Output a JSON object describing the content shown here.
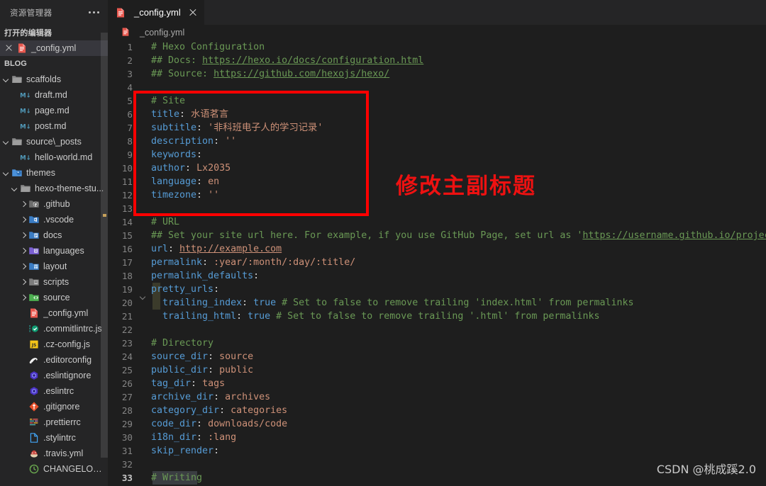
{
  "sidebar": {
    "title": "资源管理器",
    "more_icon": "ellipsis-icon",
    "open_editors_header": "打开的编辑器",
    "open_editor": {
      "name": "_config.yml",
      "icon": "yaml-file-icon",
      "close_icon": "close-icon"
    },
    "blog_header": "BLOG",
    "tree": [
      {
        "label": "scaffolds",
        "indent": 0,
        "twisty": "down",
        "icon": "folder-open-icon"
      },
      {
        "label": "draft.md",
        "indent": 1,
        "twisty": "none",
        "icon": "markdown-icon"
      },
      {
        "label": "page.md",
        "indent": 1,
        "twisty": "none",
        "icon": "markdown-icon"
      },
      {
        "label": "post.md",
        "indent": 1,
        "twisty": "none",
        "icon": "markdown-icon"
      },
      {
        "label": "source\\_posts",
        "indent": 0,
        "twisty": "down",
        "icon": "folder-open-icon"
      },
      {
        "label": "hello-world.md",
        "indent": 1,
        "twisty": "none",
        "icon": "markdown-icon"
      },
      {
        "label": "themes",
        "indent": 0,
        "twisty": "down",
        "icon": "folder-theme-icon"
      },
      {
        "label": "hexo-theme-stu...",
        "indent": 1,
        "twisty": "down",
        "icon": "folder-open-icon"
      },
      {
        "label": ".github",
        "indent": 2,
        "twisty": "right",
        "icon": "folder-github-icon"
      },
      {
        "label": ".vscode",
        "indent": 2,
        "twisty": "right",
        "icon": "folder-vscode-icon"
      },
      {
        "label": "docs",
        "indent": 2,
        "twisty": "right",
        "icon": "folder-docs-icon"
      },
      {
        "label": "languages",
        "indent": 2,
        "twisty": "right",
        "icon": "folder-languages-icon"
      },
      {
        "label": "layout",
        "indent": 2,
        "twisty": "right",
        "icon": "folder-layout-icon"
      },
      {
        "label": "scripts",
        "indent": 2,
        "twisty": "right",
        "icon": "folder-scripts-icon"
      },
      {
        "label": "source",
        "indent": 2,
        "twisty": "right",
        "icon": "folder-source-icon"
      },
      {
        "label": "_config.yml",
        "indent": 2,
        "twisty": "none",
        "icon": "yaml-file-icon"
      },
      {
        "label": ".commitlintrc.js",
        "indent": 2,
        "twisty": "none",
        "icon": "commitlint-icon"
      },
      {
        "label": ".cz-config.js",
        "indent": 2,
        "twisty": "none",
        "icon": "javascript-icon"
      },
      {
        "label": ".editorconfig",
        "indent": 2,
        "twisty": "none",
        "icon": "editorconfig-icon"
      },
      {
        "label": ".eslintignore",
        "indent": 2,
        "twisty": "none",
        "icon": "eslint-icon"
      },
      {
        "label": ".eslintrc",
        "indent": 2,
        "twisty": "none",
        "icon": "eslint-icon"
      },
      {
        "label": ".gitignore",
        "indent": 2,
        "twisty": "none",
        "icon": "git-icon"
      },
      {
        "label": ".prettierrc",
        "indent": 2,
        "twisty": "none",
        "icon": "prettier-icon"
      },
      {
        "label": ".stylintrc",
        "indent": 2,
        "twisty": "none",
        "icon": "file-icon"
      },
      {
        "label": ".travis.yml",
        "indent": 2,
        "twisty": "none",
        "icon": "travis-icon"
      },
      {
        "label": "CHANGELOG.md",
        "indent": 2,
        "twisty": "none",
        "icon": "changelog-icon"
      }
    ]
  },
  "editor": {
    "tab": {
      "label": "_config.yml",
      "icon": "yaml-file-icon",
      "close_icon": "close-icon"
    },
    "breadcrumb": {
      "label": "_config.yml",
      "icon": "yaml-file-icon"
    },
    "lines": [
      {
        "n": "1",
        "fold": false,
        "segs": [
          {
            "t": "# Hexo Configuration",
            "c": "c-comment"
          }
        ]
      },
      {
        "n": "2",
        "fold": false,
        "segs": [
          {
            "t": "## Docs: ",
            "c": "c-comment"
          },
          {
            "t": "https://hexo.io/docs/configuration.html",
            "c": "c-link"
          }
        ]
      },
      {
        "n": "3",
        "fold": false,
        "segs": [
          {
            "t": "## Source: ",
            "c": "c-comment"
          },
          {
            "t": "https://github.com/hexojs/hexo/",
            "c": "c-link"
          }
        ]
      },
      {
        "n": "4",
        "fold": false,
        "segs": []
      },
      {
        "n": "5",
        "fold": false,
        "segs": [
          {
            "t": "# Site",
            "c": "c-comment"
          }
        ]
      },
      {
        "n": "6",
        "fold": false,
        "segs": [
          {
            "t": "title",
            "c": "c-key"
          },
          {
            "t": ": ",
            "c": "c-punc"
          },
          {
            "t": "水语茗言",
            "c": "c-val"
          }
        ]
      },
      {
        "n": "7",
        "fold": false,
        "segs": [
          {
            "t": "subtitle",
            "c": "c-key"
          },
          {
            "t": ": ",
            "c": "c-punc"
          },
          {
            "t": "'非科班电子人的学习记录'",
            "c": "c-val"
          }
        ]
      },
      {
        "n": "8",
        "fold": false,
        "segs": [
          {
            "t": "description",
            "c": "c-key"
          },
          {
            "t": ": ",
            "c": "c-punc"
          },
          {
            "t": "''",
            "c": "c-val"
          }
        ]
      },
      {
        "n": "9",
        "fold": false,
        "segs": [
          {
            "t": "keywords",
            "c": "c-key"
          },
          {
            "t": ":",
            "c": "c-punc"
          }
        ]
      },
      {
        "n": "10",
        "fold": false,
        "segs": [
          {
            "t": "author",
            "c": "c-key"
          },
          {
            "t": ": ",
            "c": "c-punc"
          },
          {
            "t": "Lx2035",
            "c": "c-val"
          }
        ]
      },
      {
        "n": "11",
        "fold": false,
        "segs": [
          {
            "t": "language",
            "c": "c-key"
          },
          {
            "t": ": ",
            "c": "c-punc"
          },
          {
            "t": "en",
            "c": "c-val"
          }
        ]
      },
      {
        "n": "12",
        "fold": false,
        "segs": [
          {
            "t": "timezone",
            "c": "c-key"
          },
          {
            "t": ": ",
            "c": "c-punc"
          },
          {
            "t": "''",
            "c": "c-val"
          }
        ]
      },
      {
        "n": "13",
        "fold": false,
        "segs": []
      },
      {
        "n": "14",
        "fold": false,
        "segs": [
          {
            "t": "# URL",
            "c": "c-comment"
          }
        ]
      },
      {
        "n": "15",
        "fold": false,
        "segs": [
          {
            "t": "## Set your site url here. For example, if you use GitHub Page, set url as ",
            "c": "c-comment"
          },
          {
            "t": "'",
            "c": "c-comment"
          },
          {
            "t": "https://username.github.io/project",
            "c": "c-link"
          },
          {
            "t": "'",
            "c": "c-comment"
          }
        ]
      },
      {
        "n": "16",
        "fold": false,
        "segs": [
          {
            "t": "url",
            "c": "c-key"
          },
          {
            "t": ": ",
            "c": "c-punc"
          },
          {
            "t": "http://example.com",
            "c": "c-link-o"
          }
        ]
      },
      {
        "n": "17",
        "fold": false,
        "segs": [
          {
            "t": "permalink",
            "c": "c-key"
          },
          {
            "t": ": ",
            "c": "c-punc"
          },
          {
            "t": ":year/:month/:day/:title/",
            "c": "c-val"
          }
        ]
      },
      {
        "n": "18",
        "fold": false,
        "segs": [
          {
            "t": "permalink_defaults",
            "c": "c-key"
          },
          {
            "t": ":",
            "c": "c-punc"
          }
        ]
      },
      {
        "n": "19",
        "fold": true,
        "segs": [
          {
            "t": "pretty_urls",
            "c": "c-key"
          },
          {
            "t": ":",
            "c": "c-punc"
          }
        ]
      },
      {
        "n": "20",
        "fold": false,
        "segs": [
          {
            "t": "  trailing_index",
            "c": "c-key"
          },
          {
            "t": ": ",
            "c": "c-punc"
          },
          {
            "t": "true",
            "c": "c-bool"
          },
          {
            "t": " # Set to false to remove trailing 'index.html' from permalinks",
            "c": "c-comment"
          }
        ]
      },
      {
        "n": "21",
        "fold": false,
        "segs": [
          {
            "t": "  trailing_html",
            "c": "c-key"
          },
          {
            "t": ": ",
            "c": "c-punc"
          },
          {
            "t": "true",
            "c": "c-bool"
          },
          {
            "t": " # Set to false to remove trailing '.html' from permalinks",
            "c": "c-comment"
          }
        ]
      },
      {
        "n": "22",
        "fold": false,
        "segs": []
      },
      {
        "n": "23",
        "fold": false,
        "segs": [
          {
            "t": "# Directory",
            "c": "c-comment"
          }
        ]
      },
      {
        "n": "24",
        "fold": false,
        "segs": [
          {
            "t": "source_dir",
            "c": "c-key"
          },
          {
            "t": ": ",
            "c": "c-punc"
          },
          {
            "t": "source",
            "c": "c-val"
          }
        ]
      },
      {
        "n": "25",
        "fold": false,
        "segs": [
          {
            "t": "public_dir",
            "c": "c-key"
          },
          {
            "t": ": ",
            "c": "c-punc"
          },
          {
            "t": "public",
            "c": "c-val"
          }
        ]
      },
      {
        "n": "26",
        "fold": false,
        "segs": [
          {
            "t": "tag_dir",
            "c": "c-key"
          },
          {
            "t": ": ",
            "c": "c-punc"
          },
          {
            "t": "tags",
            "c": "c-val"
          }
        ]
      },
      {
        "n": "27",
        "fold": false,
        "segs": [
          {
            "t": "archive_dir",
            "c": "c-key"
          },
          {
            "t": ": ",
            "c": "c-punc"
          },
          {
            "t": "archives",
            "c": "c-val"
          }
        ]
      },
      {
        "n": "28",
        "fold": false,
        "segs": [
          {
            "t": "category_dir",
            "c": "c-key"
          },
          {
            "t": ": ",
            "c": "c-punc"
          },
          {
            "t": "categories",
            "c": "c-val"
          }
        ]
      },
      {
        "n": "29",
        "fold": false,
        "segs": [
          {
            "t": "code_dir",
            "c": "c-key"
          },
          {
            "t": ": ",
            "c": "c-punc"
          },
          {
            "t": "downloads/code",
            "c": "c-val"
          }
        ]
      },
      {
        "n": "30",
        "fold": false,
        "segs": [
          {
            "t": "i18n_dir",
            "c": "c-key"
          },
          {
            "t": ": ",
            "c": "c-punc"
          },
          {
            "t": ":lang",
            "c": "c-val"
          }
        ]
      },
      {
        "n": "31",
        "fold": false,
        "segs": [
          {
            "t": "skip_render",
            "c": "c-key"
          },
          {
            "t": ":",
            "c": "c-punc"
          }
        ]
      },
      {
        "n": "32",
        "fold": false,
        "segs": []
      },
      {
        "n": "33",
        "fold": false,
        "active": true,
        "segs": [
          {
            "t": "# Writing",
            "c": "c-comment"
          }
        ]
      }
    ]
  },
  "annotation": {
    "text": "修改主副标题",
    "box_color": "#ff0000",
    "text_color": "#ee1111"
  },
  "watermark": "CSDN @桃成蹊2.0"
}
